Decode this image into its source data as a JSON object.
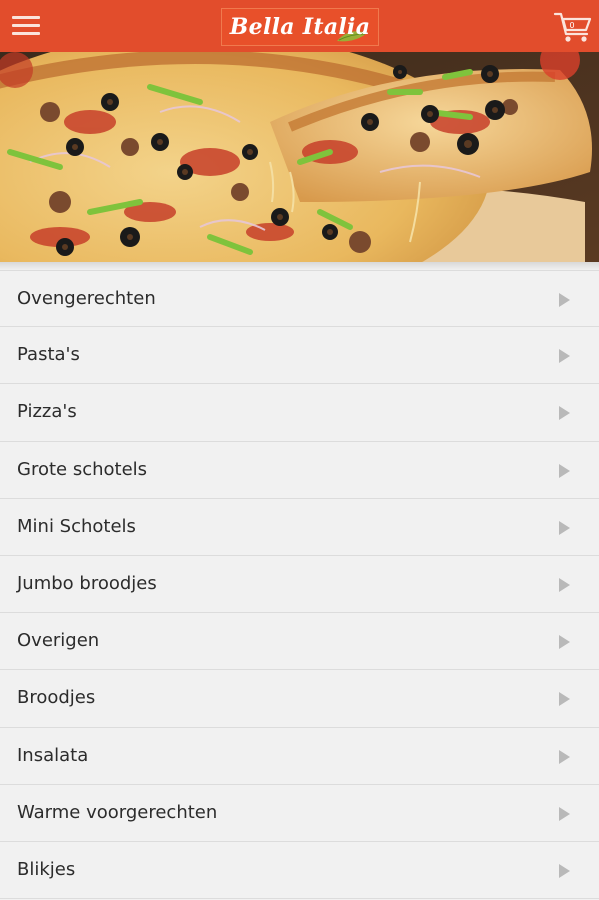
{
  "header": {
    "logo_text": "Bella Italia",
    "cart_count": "0",
    "menu_icon": "hamburger-menu-icon",
    "cart_icon": "shopping-cart-icon",
    "bg_color": "#e24d2c"
  },
  "hero": {
    "image": "pizza-photo"
  },
  "categories": [
    {
      "label": "Ovengerechten"
    },
    {
      "label": "Pasta's"
    },
    {
      "label": "Pizza's"
    },
    {
      "label": "Grote schotels"
    },
    {
      "label": "Mini Schotels"
    },
    {
      "label": "Jumbo broodjes"
    },
    {
      "label": "Overigen"
    },
    {
      "label": "Broodjes"
    },
    {
      "label": "Insalata"
    },
    {
      "label": "Warme voorgerechten"
    },
    {
      "label": "Blikjes"
    }
  ]
}
